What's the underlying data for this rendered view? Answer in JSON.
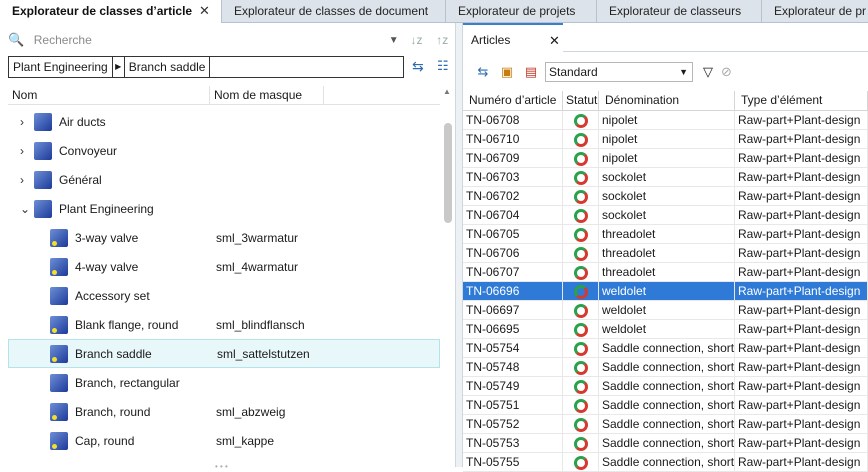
{
  "tabs": [
    {
      "label": "Explorateur de classes d’article",
      "close": "✕"
    },
    {
      "label": "Explorateur de classes de document"
    },
    {
      "label": "Explorateur de projets"
    },
    {
      "label": "Explorateur de classeurs"
    },
    {
      "label": "Explorateur de pr"
    }
  ],
  "left": {
    "search_placeholder": "Recherche",
    "breadcrumb": [
      "Plant Engineering",
      "Branch saddle"
    ],
    "columns": {
      "name": "Nom",
      "mask": "Nom de masque"
    },
    "tree": [
      {
        "label": "Air ducts",
        "mask": "",
        "expandable": true,
        "leaf": false
      },
      {
        "label": "Convoyeur",
        "mask": "",
        "expandable": true,
        "leaf": false
      },
      {
        "label": "Général",
        "mask": "",
        "expandable": true,
        "leaf": false
      },
      {
        "label": "Plant Engineering",
        "mask": "",
        "expandable": true,
        "expanded": true,
        "leaf": false
      },
      {
        "label": "3-way valve",
        "mask": "sml_3warmatur",
        "leaf": true
      },
      {
        "label": "4-way valve",
        "mask": "sml_4warmatur",
        "leaf": true
      },
      {
        "label": "Accessory set",
        "mask": "",
        "leaf": false,
        "child": true
      },
      {
        "label": "Blank flange, round",
        "mask": "sml_blindflansch",
        "leaf": true
      },
      {
        "label": "Branch saddle",
        "mask": "sml_sattelstutzen",
        "leaf": true,
        "selected": true
      },
      {
        "label": "Branch, rectangular",
        "mask": "",
        "leaf": false,
        "child": true
      },
      {
        "label": "Branch, round",
        "mask": "sml_abzweig",
        "leaf": true
      },
      {
        "label": "Cap, round",
        "mask": "sml_kappe",
        "leaf": true
      }
    ]
  },
  "right": {
    "tab_label": "Articles",
    "tab_close": "✕",
    "view_select": "Standard",
    "columns": [
      "Numéro d’article",
      "Statut",
      "Dénomination",
      "Type d’élément"
    ],
    "rows": [
      {
        "num": "TN-06708",
        "name": "nipolet",
        "type": "Raw-part+Plant-design"
      },
      {
        "num": "TN-06710",
        "name": "nipolet",
        "type": "Raw-part+Plant-design"
      },
      {
        "num": "TN-06709",
        "name": "nipolet",
        "type": "Raw-part+Plant-design"
      },
      {
        "num": "TN-06703",
        "name": "sockolet",
        "type": "Raw-part+Plant-design"
      },
      {
        "num": "TN-06702",
        "name": "sockolet",
        "type": "Raw-part+Plant-design"
      },
      {
        "num": "TN-06704",
        "name": "sockolet",
        "type": "Raw-part+Plant-design"
      },
      {
        "num": "TN-06705",
        "name": "threadolet",
        "type": "Raw-part+Plant-design"
      },
      {
        "num": "TN-06706",
        "name": "threadolet",
        "type": "Raw-part+Plant-design"
      },
      {
        "num": "TN-06707",
        "name": "threadolet",
        "type": "Raw-part+Plant-design"
      },
      {
        "num": "TN-06696",
        "name": "weldolet",
        "type": "Raw-part+Plant-design",
        "selected": true
      },
      {
        "num": "TN-06697",
        "name": "weldolet",
        "type": "Raw-part+Plant-design"
      },
      {
        "num": "TN-06695",
        "name": "weldolet",
        "type": "Raw-part+Plant-design"
      },
      {
        "num": "TN-05754",
        "name": "Saddle connection, short",
        "type": "Raw-part+Plant-design"
      },
      {
        "num": "TN-05748",
        "name": "Saddle connection, short",
        "type": "Raw-part+Plant-design"
      },
      {
        "num": "TN-05749",
        "name": "Saddle connection, short",
        "type": "Raw-part+Plant-design"
      },
      {
        "num": "TN-05751",
        "name": "Saddle connection, short",
        "type": "Raw-part+Plant-design"
      },
      {
        "num": "TN-05752",
        "name": "Saddle connection, short",
        "type": "Raw-part+Plant-design"
      },
      {
        "num": "TN-05753",
        "name": "Saddle connection, short",
        "type": "Raw-part+Plant-design"
      },
      {
        "num": "TN-05755",
        "name": "Saddle connection, short",
        "type": "Raw-part+Plant-design"
      }
    ]
  }
}
